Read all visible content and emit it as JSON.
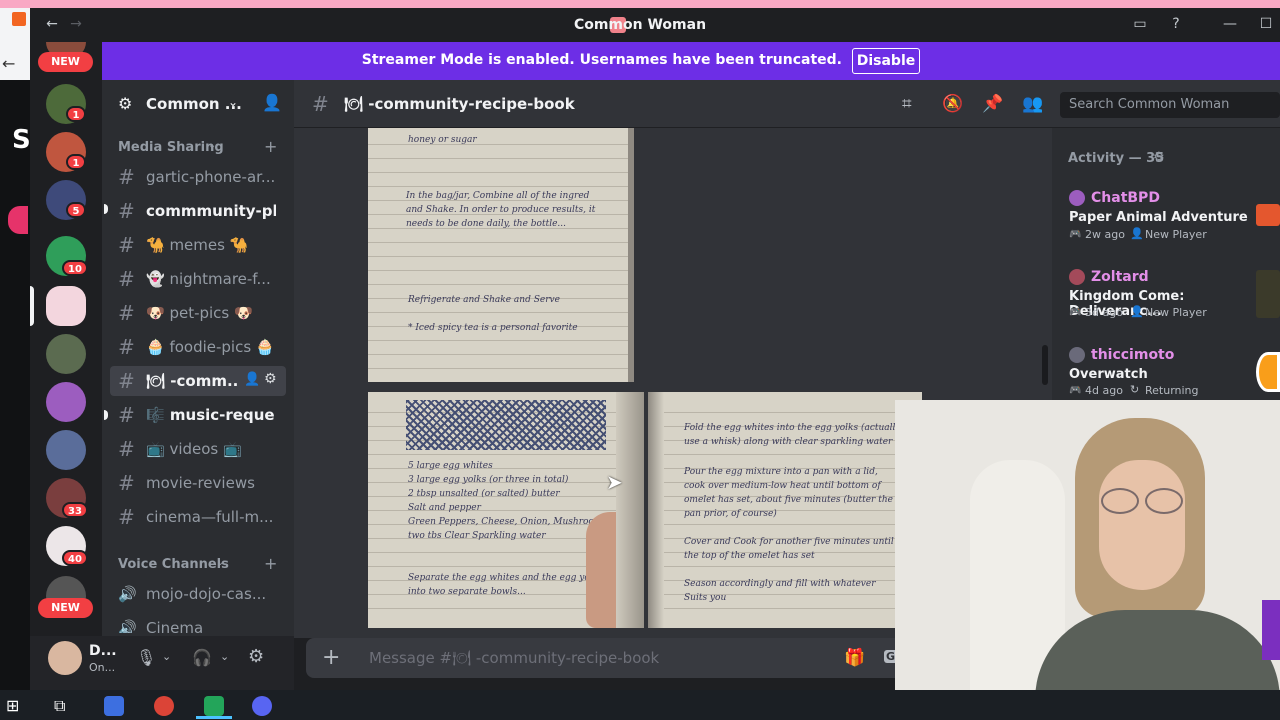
{
  "window": {
    "title": "Common Woman"
  },
  "banner": {
    "text": "Streamer Mode is enabled. Usernames have been truncated.",
    "button": "Disable"
  },
  "rail": {
    "new_label": "NEW",
    "badges": [
      "1",
      "1",
      "5",
      "10",
      "33",
      "40"
    ]
  },
  "server": {
    "name": "Common ..."
  },
  "sidebar": {
    "category_media": "Media Sharing",
    "channels": [
      {
        "label": "gartic-phone-ar...",
        "state": "normal"
      },
      {
        "label": "commmunity-ph...",
        "state": "bold"
      },
      {
        "label": "🐪 memes 🐪",
        "state": "normal"
      },
      {
        "label": "👻 nightmare-f...",
        "state": "normal"
      },
      {
        "label": "🐶 pet-pics 🐶",
        "state": "normal"
      },
      {
        "label": "🧁 foodie-pics 🧁",
        "state": "normal"
      },
      {
        "label": "🍽 -comm...",
        "state": "active"
      },
      {
        "label": "🎼 music-reque...",
        "state": "bold"
      },
      {
        "label": "📺 videos 📺",
        "state": "normal"
      },
      {
        "label": "movie-reviews",
        "state": "normal"
      },
      {
        "label": "cinema—full-m...",
        "state": "normal"
      }
    ],
    "category_voice": "Voice Channels",
    "voice": [
      {
        "label": "mojo-dojo-cas..."
      },
      {
        "label": "Cinema"
      }
    ]
  },
  "user": {
    "name": "D...",
    "status": "On..."
  },
  "header": {
    "channel": "🍽 -community-recipe-book",
    "search_placeholder": "Search Common Woman"
  },
  "composer": {
    "placeholder": "Message #🍽 -community-recipe-book"
  },
  "activity": {
    "title": "Activity — 35",
    "items": [
      {
        "user": "ChatBPD",
        "game": "Paper Animal Adventure",
        "time": "2w ago",
        "tag": "New Player",
        "color": "#e38fe8"
      },
      {
        "user": "Zoltard",
        "game": "Kingdom Come: Deliveranc...",
        "time": "3d ago",
        "tag": "New Player",
        "color": "#e38fe8"
      },
      {
        "user": "thiccimoto",
        "game": "Overwatch",
        "time": "4d ago",
        "tag": "Returning",
        "color": "#e38fe8"
      }
    ]
  },
  "notes": {
    "top": [
      "honey or sugar",
      "In the bag/jar, Combine all of the ingred",
      "and Shake. In order to produce results, it",
      "needs to be done daily, the bottle...",
      "Refrigerate and Shake and Serve",
      "* Iced spicy tea is a personal favorite"
    ],
    "bottom_left": [
      "5 large egg whites",
      "3 large egg yolks (or three in total)",
      "2 tbsp unsalted (or salted) butter",
      "Salt and pepper",
      "Green Peppers, Cheese, Onion, Mushrooms",
      "two tbs Clear Sparkling water",
      "Separate the egg whites and the egg yolks",
      "into two separate bowls..."
    ],
    "bottom_right": [
      "Fold the egg whites into the egg yolks (actually",
      "use a whisk) along with clear sparkling water",
      "Pour the egg mixture into a pan with a lid,",
      "cook over medium-low heat until bottom of",
      "omelet has set, about five minutes (butter the",
      "pan prior, of course)",
      "Cover and Cook for another five minutes until",
      "the top of the omelet has set",
      "Season accordingly and fill with whatever",
      "Suits you"
    ]
  }
}
